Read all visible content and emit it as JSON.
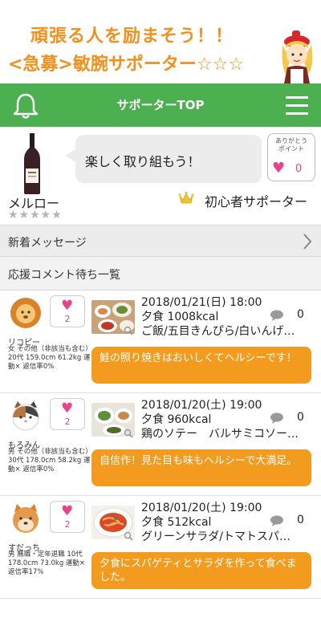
{
  "banner": {
    "line1": "頑張る人を励まそう！！",
    "line2": "<急募>敏腕サポーター☆☆☆"
  },
  "header": {
    "title": "サポーターTOP",
    "bell_icon": "bell-icon",
    "menu_icon": "hamburger-menu-icon",
    "background": "#4caf50"
  },
  "profile": {
    "message": "楽しく取り組もう！",
    "thanks_label": "ありがとう\nポイント",
    "thanks_count": "0",
    "name": "メルロー",
    "stars": "★★★★★",
    "rank": "初心者サポーター"
  },
  "new_messages": {
    "label": "新着メッセージ"
  },
  "section": {
    "label": "応援コメント待ち一覧"
  },
  "posts": [
    {
      "avatar": "lion-avatar",
      "likes": "2",
      "username": "リコピー",
      "info": "女 その他（非該当も含む）20代 159.0cm 61.2kg 運動× 返信率0%",
      "date": "2018/01/21(日) 18:00",
      "meal": "夕食 1008kcal",
      "menu": "ご飯/五目きんぴら/白いんげ…",
      "comments": "0",
      "comment": "鮭の照り焼きはおいしくてヘルシーです！"
    },
    {
      "avatar": "cat-avatar",
      "likes": "2",
      "username": "もろみん",
      "info": "男 その他（非該当も含む）30代 178.0cm 58.2kg 運動× 返信率0%",
      "date": "2018/01/20(土) 19:00",
      "meal": "夕食 960kcal",
      "menu": "鶏のソテー　バルサミコソー…",
      "comments": "0",
      "comment": "自信作！見た目も味もヘルシーで大満足。"
    },
    {
      "avatar": "shiba-dog-avatar",
      "likes": "2",
      "username": "すだっち",
      "info": "男 無職・定年退職 10代 178.0cm 73.0kg 運動× 返信率17%",
      "date": "2018/01/20(土) 19:00",
      "meal": "夕食 512kcal",
      "menu": "グリーンサラダ/トマトスパ…",
      "comments": "0",
      "comment": "夕食にスパゲティとサラダを作って食べました。"
    }
  ],
  "colors": {
    "accent_orange": "#f39b1e",
    "heart_pink": "#e6458b",
    "header_green": "#4caf50"
  }
}
